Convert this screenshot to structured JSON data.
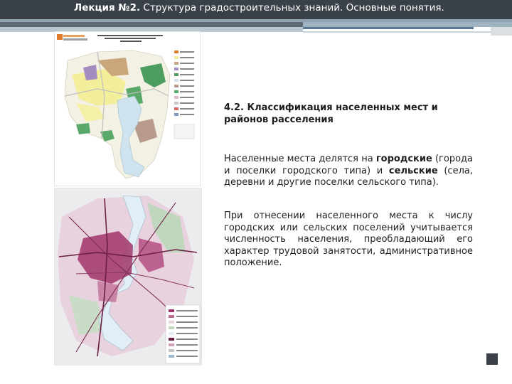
{
  "header": {
    "lecture_label": "Лекция №2.",
    "title": " Структура градостроительных знаний. Основные понятия."
  },
  "section": {
    "heading": "4.2. Классификация населенных мест и районов расселения"
  },
  "paragraph1": {
    "text_a": "Населенные места делятся на ",
    "bold_a": "городские",
    "text_b": " (города и поселки городского типа) и ",
    "bold_b": "сельские",
    "text_c": " (села, деревни и другие поселки сельского типа)."
  },
  "paragraph2": {
    "text": "При отнесении населенного места к числу городских или сельских поселений учитывается численность населения, преобладающий его характер трудовой занятости, административное положение."
  },
  "colors": {
    "header_bg": "#3a4048",
    "map_green": "#5aa86a",
    "map_water": "#cfe3ef",
    "map_magenta": "#a0356b"
  }
}
